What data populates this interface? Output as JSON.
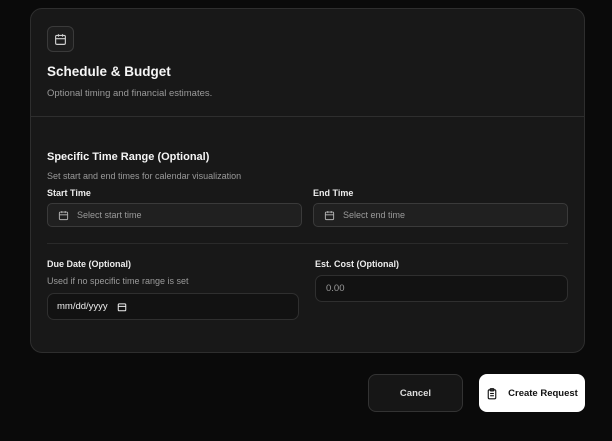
{
  "card": {
    "title": "Schedule & Budget",
    "subtitle": "Optional timing and financial estimates.",
    "icon": "calendar-icon"
  },
  "time_range": {
    "title": "Specific Time Range (Optional)",
    "description": "Set start and end times for calendar visualization",
    "start": {
      "label": "Start Time",
      "placeholder": "Select start time",
      "icon": "calendar-icon"
    },
    "end": {
      "label": "End Time",
      "placeholder": "Select end time",
      "icon": "calendar-icon"
    }
  },
  "due_date": {
    "label": "Due Date (Optional)",
    "hint": "Used if no specific time range is set",
    "value": "mm/dd/yyyy",
    "icon": "calendar-icon"
  },
  "cost": {
    "label": "Est. Cost (Optional)",
    "placeholder": "0.00"
  },
  "actions": {
    "cancel_label": "Cancel",
    "create_label": "Create Request",
    "create_icon": "clipboard-icon"
  },
  "colors": {
    "background": "#0a0a0a",
    "card": "#181818",
    "border": "#2e2e2e",
    "primary_button": "#ffffff"
  }
}
